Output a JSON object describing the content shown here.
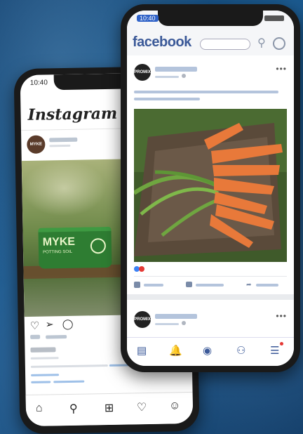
{
  "instagram": {
    "time": "10:40",
    "logo": "Instagram",
    "avatar_text": "MYKE",
    "product_brand": "MYKE",
    "product_sub": "POTTING SOIL",
    "icons": [
      "heart-icon",
      "send-icon",
      "comment-icon"
    ],
    "nav_icons": [
      "home-icon",
      "search-icon",
      "add-post-icon",
      "heart-icon",
      "profile-icon"
    ]
  },
  "facebook": {
    "time": "10:40",
    "logo": "facebook",
    "avatar_text": "PROMIX",
    "nav_icons": [
      "news-feed-icon",
      "notifications-icon",
      "groups-icon",
      "friends-icon",
      "menu-icon"
    ]
  },
  "colors": {
    "fb_blue": "#3b5998",
    "ig_green": "#2e7d32",
    "carrot": "#e8793a"
  }
}
